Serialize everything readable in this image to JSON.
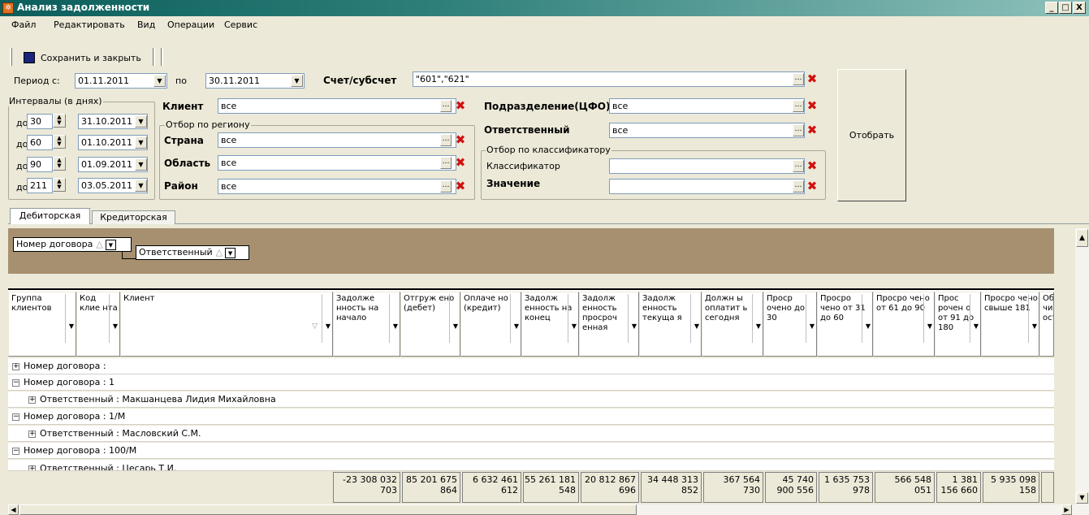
{
  "window": {
    "title": "Анализ задолженности",
    "minimize": "_",
    "maximize": "□",
    "close": "X"
  },
  "menu": [
    "Файл",
    "Редактировать",
    "Вид",
    "Операции",
    "Сервис"
  ],
  "toolbar": {
    "save_close_label": "Сохранить и закрыть"
  },
  "period": {
    "from_label": "Период с:",
    "from_value": "01.11.2011",
    "to_label": "по",
    "to_value": "30.11.2011"
  },
  "account": {
    "label": "Счет/субсчет",
    "value": "\"601\",\"621\""
  },
  "intervals": {
    "title": "Интервалы (в днях)",
    "prefix": "до",
    "items": [
      {
        "days": "30",
        "date": "31.10.2011"
      },
      {
        "days": "60",
        "date": "01.10.2011"
      },
      {
        "days": "90",
        "date": "01.09.2011"
      },
      {
        "days": "211",
        "date": "03.05.2011"
      }
    ]
  },
  "client": {
    "label": "Клиент",
    "value": "все"
  },
  "region": {
    "title": "Отбор по региону",
    "country_label": "Страна",
    "country_value": "все",
    "area_label": "Область",
    "area_value": "все",
    "district_label": "Район",
    "district_value": "все"
  },
  "division": {
    "label": "Подразделение(ЦФО)",
    "value": "все"
  },
  "responsible": {
    "label": "Ответственный",
    "value": "все"
  },
  "classifier": {
    "title": "Отбор по классификатору",
    "classifier_label": "Классификатор",
    "classifier_value": "",
    "value_label": "Значение",
    "value_value": ""
  },
  "select_button": "Отобрать",
  "tabs": [
    "Дебиторская",
    "Кредиторская"
  ],
  "grouping": {
    "chip1": "Номер договора",
    "chip2": "Ответственный"
  },
  "columns": [
    "Группа клиентов",
    "Код клие нта",
    "Клиент",
    "Задолже нность на начало",
    "Отгруж ено (дебет)",
    "Оплаче но (кредит)",
    "Задолж енность на конец",
    "Задолж енность просроч енная",
    "Задолж енность текуща я",
    "Должн ы оплатит ь сегодня",
    "Проср очено до 30",
    "Просро чено от 31 до 60",
    "Просро чено от 61 до 90",
    "Проc рочен о от 91 до 180",
    "Просро чено свыше 181",
    "Обора чиваем ость"
  ],
  "rows": [
    {
      "text": "Номер договора :",
      "sign": "+",
      "level": 0
    },
    {
      "text": "Номер договора : 1",
      "sign": "−",
      "level": 0
    },
    {
      "text": "Ответственный : Макшанцева Лидия Михайловна",
      "sign": "+",
      "level": 1
    },
    {
      "text": "Номер договора : 1/М",
      "sign": "−",
      "level": 0
    },
    {
      "text": "Ответственный : Масловский С.М.",
      "sign": "+",
      "level": 1
    },
    {
      "text": "Номер договора : 100/М",
      "sign": "−",
      "level": 0
    },
    {
      "text": "Ответственный : Цесарь Т.И.",
      "sign": "+",
      "level": 1
    }
  ],
  "totals": [
    [
      "-23 308 032",
      "703"
    ],
    [
      "85 201 675",
      "864"
    ],
    [
      "6 632 461",
      "612"
    ],
    [
      "55 261 181",
      "548"
    ],
    [
      "20 812 867",
      "696"
    ],
    [
      "34 448 313",
      "852"
    ],
    [
      "367 564",
      "730"
    ],
    [
      "45 740",
      "900 556"
    ],
    [
      "1 635 753",
      "978"
    ],
    [
      "566 548",
      "051"
    ],
    [
      "1 381",
      "156 660"
    ],
    [
      "5 935 098",
      "158"
    ],
    [
      "",
      ""
    ]
  ]
}
